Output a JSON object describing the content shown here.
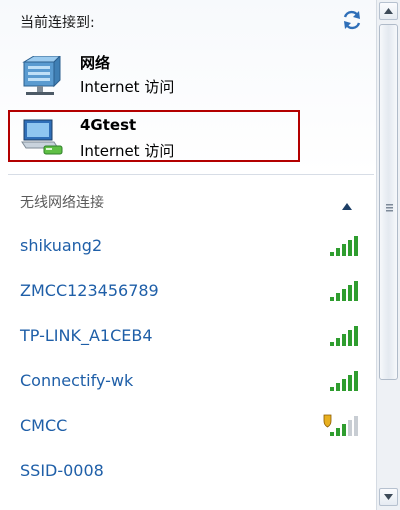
{
  "header": {
    "title": "当前连接到:"
  },
  "connected": [
    {
      "name": "网络",
      "status": "Internet 访问"
    },
    {
      "name": "4Gtest",
      "status": "Internet 访问"
    }
  ],
  "section": {
    "title": "无线网络连接"
  },
  "networks": [
    {
      "ssid": "shikuang2",
      "signal": 5,
      "secured": false
    },
    {
      "ssid": "ZMCC123456789",
      "signal": 5,
      "secured": false
    },
    {
      "ssid": "TP-LINK_A1CEB4",
      "signal": 5,
      "secured": false
    },
    {
      "ssid": "Connectify-wk",
      "signal": 5,
      "secured": false
    },
    {
      "ssid": "CMCC",
      "signal": 3,
      "secured": true
    },
    {
      "ssid": "SSID-0008",
      "signal": 0,
      "secured": false
    }
  ],
  "icons": {
    "refresh": "refresh-icon",
    "wired": "network-wired-icon",
    "modem": "network-modem-icon",
    "collapse": "chevron-up-icon",
    "signal": "signal-bars-icon",
    "shield": "shield-icon"
  },
  "colors": {
    "link": "#1f5fa8",
    "highlight": "#b30000",
    "signal": "#2f9d2f"
  }
}
